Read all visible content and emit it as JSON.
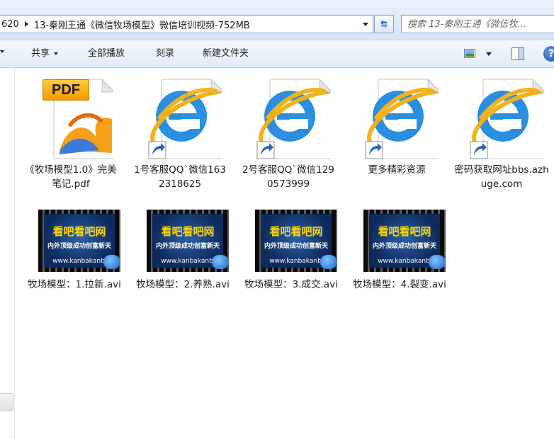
{
  "address": {
    "prev_segment": "620",
    "current_folder": "13-秦刚王通《微信牧场模型》微信培训视频-752MB"
  },
  "search": {
    "placeholder": "搜索 13-秦刚王通《微信牧..."
  },
  "toolbar": {
    "share_label": "共享",
    "play_all_label": "全部播放",
    "burn_label": "刻录",
    "new_folder_label": "新建文件夹",
    "help_label": "?"
  },
  "files": [
    {
      "name": "《牧场模型1.0》完美笔记.pdf",
      "type": "pdf",
      "badge": "PDF"
    },
    {
      "name": "1号客服QQ`微信1632318625",
      "type": "url-shortcut"
    },
    {
      "name": "2号客服QQ`微信1290573999",
      "type": "url-shortcut"
    },
    {
      "name": "更多精彩资源",
      "type": "url-shortcut"
    },
    {
      "name": "密码获取网址bbs.azhuge.com",
      "type": "url-shortcut"
    },
    {
      "name": "牧场模型：1.拉新.avi",
      "type": "video"
    },
    {
      "name": "牧场模型：2.养熟.avi",
      "type": "video"
    },
    {
      "name": "牧场模型：3.成交.avi",
      "type": "video"
    },
    {
      "name": "牧场模型：4.裂变.avi",
      "type": "video"
    }
  ],
  "thumbnail": {
    "title": "看吧看吧网",
    "subtitle": "内外顶级成功创富新天",
    "url": "www.kanbakanb"
  },
  "colors": {
    "ie_blue": "#2a8fe0",
    "ie_ring": "#f2b21c",
    "pdf_badge": "#f6a800",
    "thumb_title": "#ffd800",
    "thumb_bg": "#0c2a5c"
  }
}
